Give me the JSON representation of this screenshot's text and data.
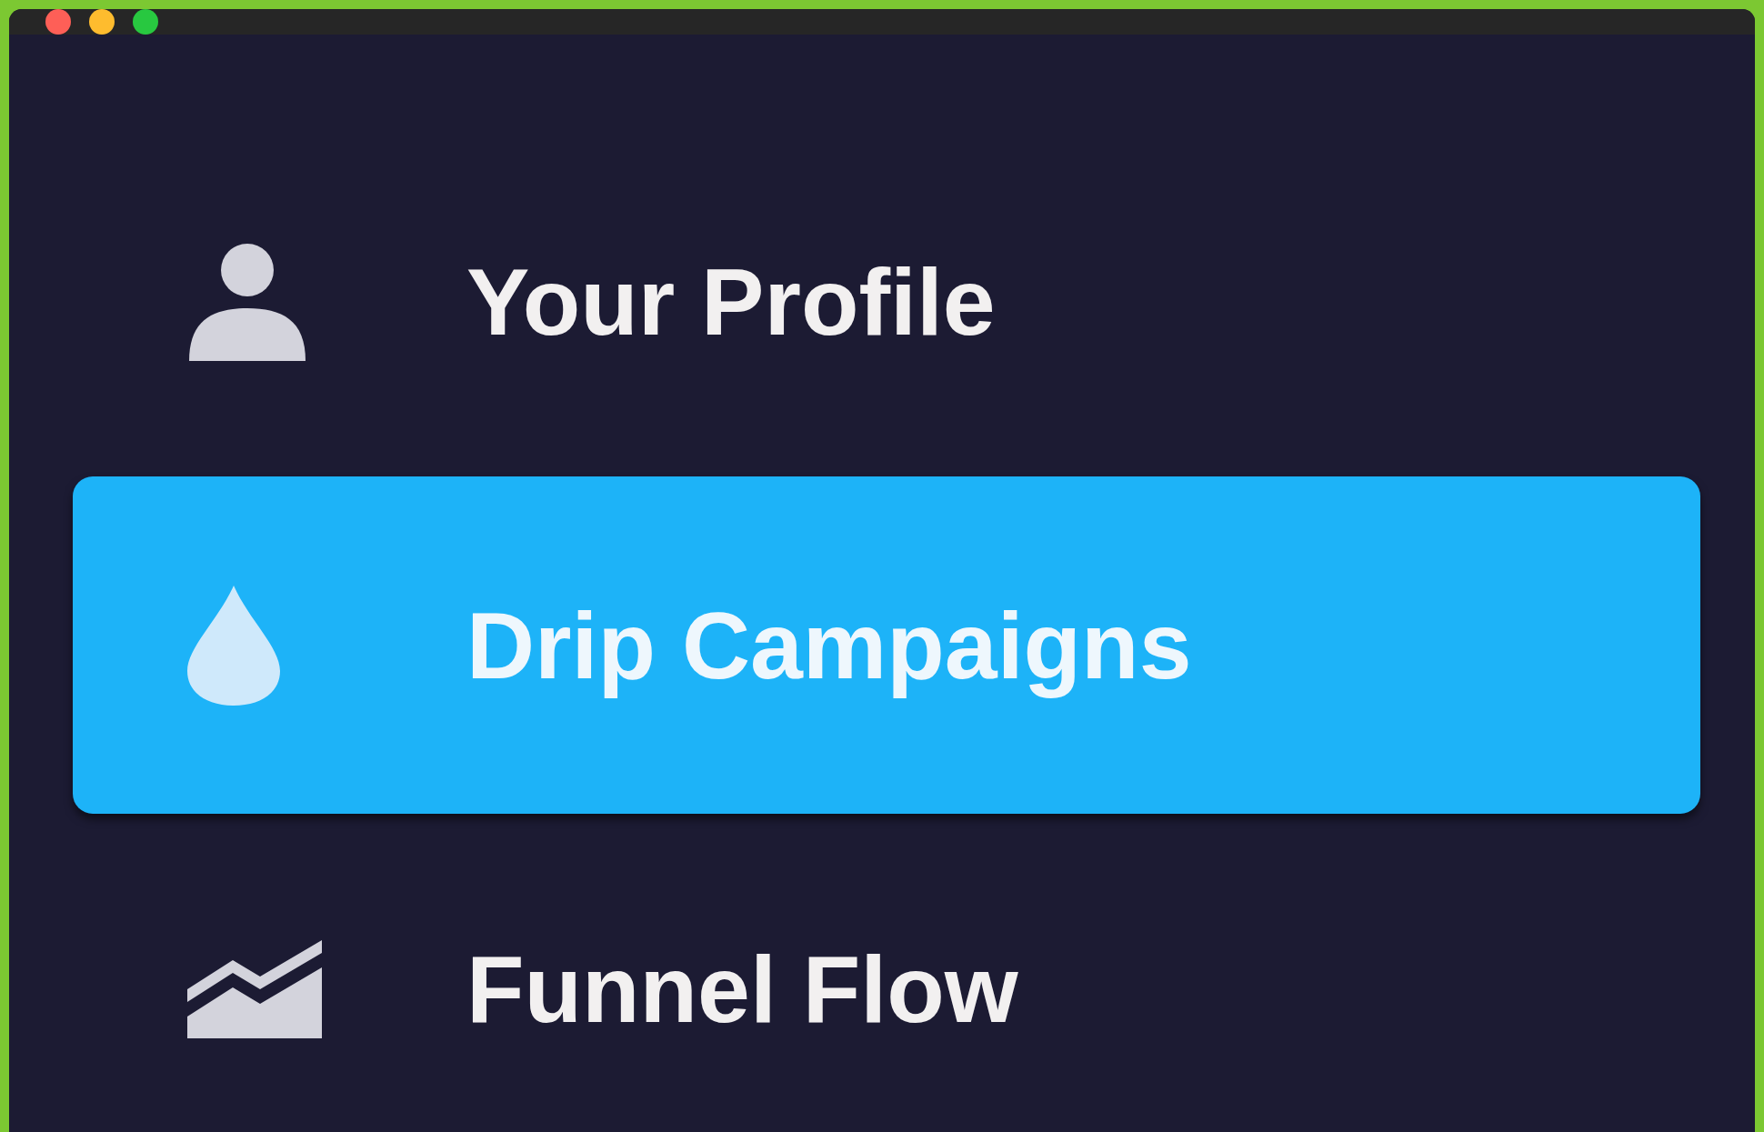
{
  "sidebar": {
    "items": [
      {
        "kind": "person",
        "label": "Your Profile",
        "selected": false
      },
      {
        "kind": "drop",
        "label": "Drip Campaigns",
        "selected": true
      },
      {
        "kind": "area-chart",
        "label": "Funnel Flow",
        "selected": false
      }
    ]
  }
}
